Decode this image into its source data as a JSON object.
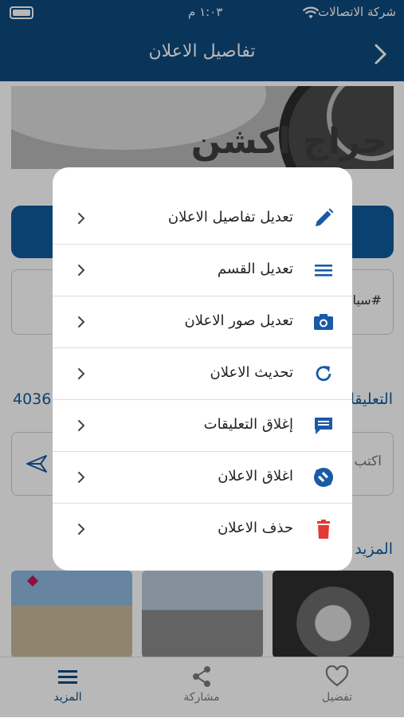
{
  "status_bar": {
    "carrier": "شركة الاتصالات",
    "time": "١:٠٣ م"
  },
  "header": {
    "title": "تفاصيل الاعلان"
  },
  "background": {
    "hero_text": "حراج اكشن",
    "tags_text": "#سيا",
    "comments_title": "التعليقات",
    "ad_number": "4036",
    "comment_placeholder": "اكتب",
    "more_title": "المزيد"
  },
  "menu": {
    "items": [
      {
        "label": "تعديل تفاصيل الاعلان",
        "icon": "pencil-icon",
        "color": "#1a5aa6"
      },
      {
        "label": "تعديل القسم",
        "icon": "menu-lines-icon",
        "color": "#1a5aa6"
      },
      {
        "label": "تعديل صور الاعلان",
        "icon": "camera-icon",
        "color": "#1a5aa6"
      },
      {
        "label": "تحديث الاعلان",
        "icon": "refresh-icon",
        "color": "#1a5aa6"
      },
      {
        "label": "إغلاق التعليقات",
        "icon": "comment-icon",
        "color": "#1a5aa6"
      },
      {
        "label": "اغلاق الاعلان",
        "icon": "block-icon",
        "color": "#1a5aa6"
      },
      {
        "label": "حذف الاعلان",
        "icon": "trash-icon",
        "color": "#e53935"
      }
    ]
  },
  "tabs": {
    "favorite": "تفضيل",
    "share": "مشاركة",
    "more": "المزيد"
  },
  "colors": {
    "primary": "#0f4a7e",
    "delete": "#e53935"
  }
}
